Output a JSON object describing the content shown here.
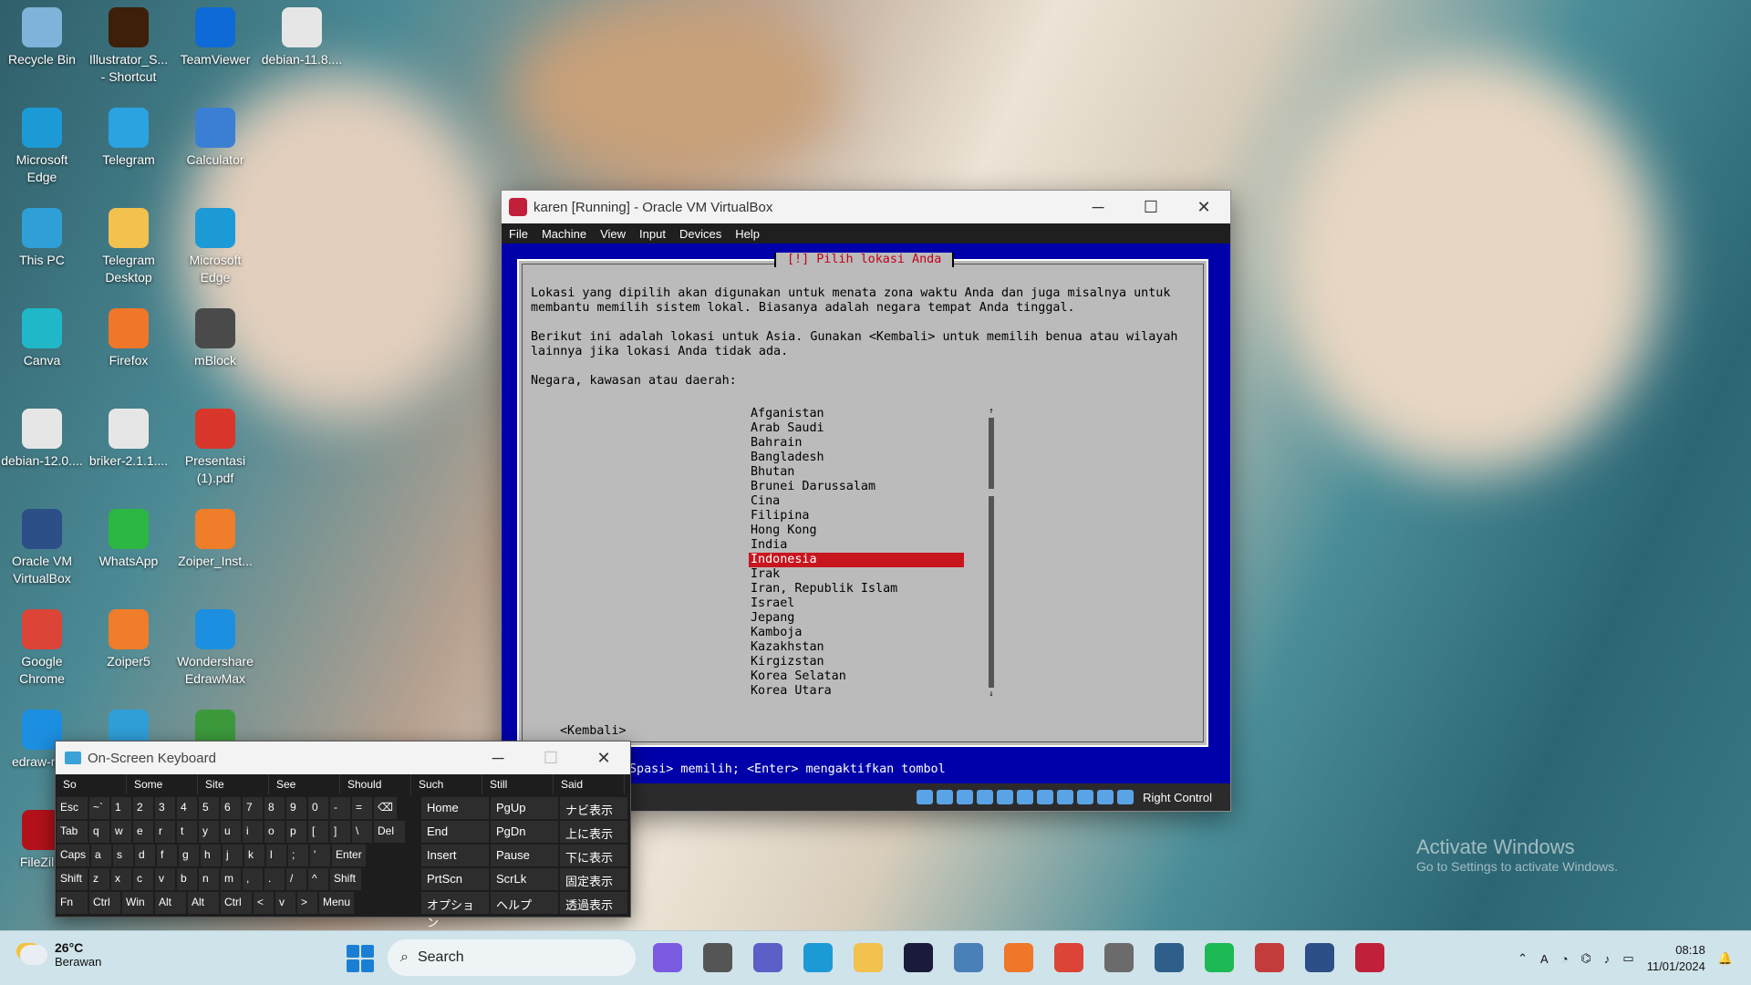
{
  "desktop_icons": [
    {
      "label": "Recycle Bin",
      "icon": "recycle-bin-icon",
      "color": "#7fb3d9"
    },
    {
      "label": "Illustrator_S... - Shortcut",
      "icon": "illustrator-icon",
      "color": "#3d1f0a"
    },
    {
      "label": "TeamViewer",
      "icon": "teamviewer-icon",
      "color": "#0e6ad6"
    },
    {
      "label": "debian-11.8....",
      "icon": "disc-image-icon",
      "color": "#e6e6e6"
    },
    {
      "label": "Microsoft Edge",
      "icon": "edge-icon",
      "color": "#1c9ad6"
    },
    {
      "label": "Telegram",
      "icon": "telegram-icon",
      "color": "#2aa3e0"
    },
    {
      "label": "Calculator",
      "icon": "calculator-icon",
      "color": "#3b7fd4"
    },
    {
      "label": "This PC",
      "icon": "monitor-icon",
      "color": "#2f9fd8"
    },
    {
      "label": "Telegram Desktop",
      "icon": "folder-icon",
      "color": "#f2c14e"
    },
    {
      "label": "Microsoft Edge",
      "icon": "edge-icon",
      "color": "#1c9ad6"
    },
    {
      "label": "Canva",
      "icon": "canva-icon",
      "color": "#20b8c8"
    },
    {
      "label": "Firefox",
      "icon": "firefox-icon",
      "color": "#f0762a"
    },
    {
      "label": "mBlock",
      "icon": "panda-icon",
      "color": "#4a4a4a"
    },
    {
      "label": "debian-12.0....",
      "icon": "disc-image-icon",
      "color": "#e6e6e6"
    },
    {
      "label": "briker-2.1.1....",
      "icon": "disc-image-icon",
      "color": "#e6e6e6"
    },
    {
      "label": "Presentasi (1).pdf",
      "icon": "pdf-icon",
      "color": "#d8362b"
    },
    {
      "label": "Oracle VM VirtualBox",
      "icon": "virtualbox-icon",
      "color": "#2b4f86"
    },
    {
      "label": "WhatsApp",
      "icon": "whatsapp-icon",
      "color": "#2bb741"
    },
    {
      "label": "Zoiper_Inst...",
      "icon": "zoiper-icon",
      "color": "#ef7d2a"
    },
    {
      "label": "Google Chrome",
      "icon": "chrome-icon",
      "color": "#db4437"
    },
    {
      "label": "Zoiper5",
      "icon": "zoiper-icon",
      "color": "#ef7d2a"
    },
    {
      "label": "Wondershare EdrawMax",
      "icon": "edrawmax-icon",
      "color": "#1c8fe0"
    },
    {
      "label": "edraw-m...",
      "icon": "edraw-icon",
      "color": "#1c8fe0"
    },
    {
      "label": "",
      "icon": "folder-blue-icon",
      "color": "#2f9fd8"
    },
    {
      "label": "",
      "icon": "python-icon",
      "color": "#3c9a3c"
    },
    {
      "label": "FileZilla",
      "icon": "filezilla-icon",
      "color": "#b3121a"
    }
  ],
  "virtualbox": {
    "title": "karen [Running] - Oracle VM VirtualBox",
    "menu": [
      "File",
      "Machine",
      "View",
      "Input",
      "Devices",
      "Help"
    ],
    "dialog_title": "[!] Pilih lokasi Anda",
    "paragraph1": "Lokasi yang dipilih akan digunakan untuk menata zona waktu Anda dan juga misalnya untuk\nmembantu memilih sistem lokal. Biasanya adalah negara tempat Anda tinggal.",
    "paragraph2": "Berikut ini adalah lokasi untuk Asia. Gunakan <Kembali> untuk memilih benua atau wilayah\nlainnya jika lokasi Anda tidak ada.",
    "prompt": "Negara, kawasan atau daerah:",
    "countries": [
      "Afganistan",
      "Arab Saudi",
      "Bahrain",
      "Bangladesh",
      "Bhutan",
      "Brunei Darussalam",
      "Cina",
      "Filipina",
      "Hong Kong",
      "India",
      "Indonesia",
      "Irak",
      "Iran, Republik Islam",
      "Israel",
      "Jepang",
      "Kamboja",
      "Kazakhstan",
      "Kirgizstan",
      "Korea Selatan",
      "Korea Utara"
    ],
    "selected": "Indonesia",
    "back_button": "<Kembali>",
    "hint": "Spasi> memilih; <Enter> mengaktifkan tombol",
    "host_key": "Right Control"
  },
  "osk": {
    "title": "On-Screen Keyboard",
    "predictions": [
      "So",
      "Some",
      "Site",
      "See",
      "Should",
      "Such",
      "Still",
      "Said"
    ],
    "rows": [
      [
        "Esc",
        "~`",
        "1",
        "2",
        "3",
        "4",
        "5",
        "6",
        "7",
        "8",
        "9",
        "0",
        "-",
        "=",
        "⌫"
      ],
      [
        "Tab",
        "q",
        "w",
        "e",
        "r",
        "t",
        "y",
        "u",
        "i",
        "o",
        "p",
        "[",
        "]",
        "\\",
        "Del"
      ],
      [
        "Caps",
        "a",
        "s",
        "d",
        "f",
        "g",
        "h",
        "j",
        "k",
        "l",
        ";",
        "'",
        "Enter"
      ],
      [
        "Shift",
        "z",
        "x",
        "c",
        "v",
        "b",
        "n",
        "m",
        ",",
        ".",
        "/",
        "^",
        "Shift"
      ],
      [
        "Fn",
        "Ctrl",
        "Win",
        "Alt",
        "Alt",
        "Ctrl",
        "<",
        "v",
        ">",
        "Menu"
      ]
    ],
    "right_keys": [
      "Home",
      "PgUp",
      "ナビ表示",
      "End",
      "PgDn",
      "上に表示",
      "Insert",
      "Pause",
      "下に表示",
      "PrtScn",
      "ScrLk",
      "固定表示",
      "オプション",
      "ヘルプ",
      "透過表示"
    ]
  },
  "taskbar": {
    "temperature": "26°C",
    "condition": "Berawan",
    "search_label": "Search",
    "time": "08:18",
    "date": "11/01/2024",
    "apps": [
      {
        "name": "copilot-icon",
        "color": "#7a5ae0"
      },
      {
        "name": "task-view-icon",
        "color": "#555555"
      },
      {
        "name": "meet-icon",
        "color": "#5b5fc7"
      },
      {
        "name": "edge-icon",
        "color": "#1c9ad6"
      },
      {
        "name": "file-explorer-icon",
        "color": "#f2c14e"
      },
      {
        "name": "affinity-icon",
        "color": "#1a1a3a"
      },
      {
        "name": "photos-icon",
        "color": "#4a7fb8"
      },
      {
        "name": "firefox-icon",
        "color": "#f0762a"
      },
      {
        "name": "chrome-icon",
        "color": "#db4437"
      },
      {
        "name": "settings-icon",
        "color": "#6b6b6b"
      },
      {
        "name": "terminal-icon",
        "color": "#2d5f8a"
      },
      {
        "name": "spotify-icon",
        "color": "#1db954"
      },
      {
        "name": "snipping-tool-icon",
        "color": "#c33b3b"
      },
      {
        "name": "virtualbox-icon",
        "color": "#2b4f86"
      },
      {
        "name": "vm-window-icon",
        "color": "#c0203a"
      }
    ]
  },
  "watermark": {
    "line1": "Activate Windows",
    "line2": "Go to Settings to activate Windows."
  }
}
